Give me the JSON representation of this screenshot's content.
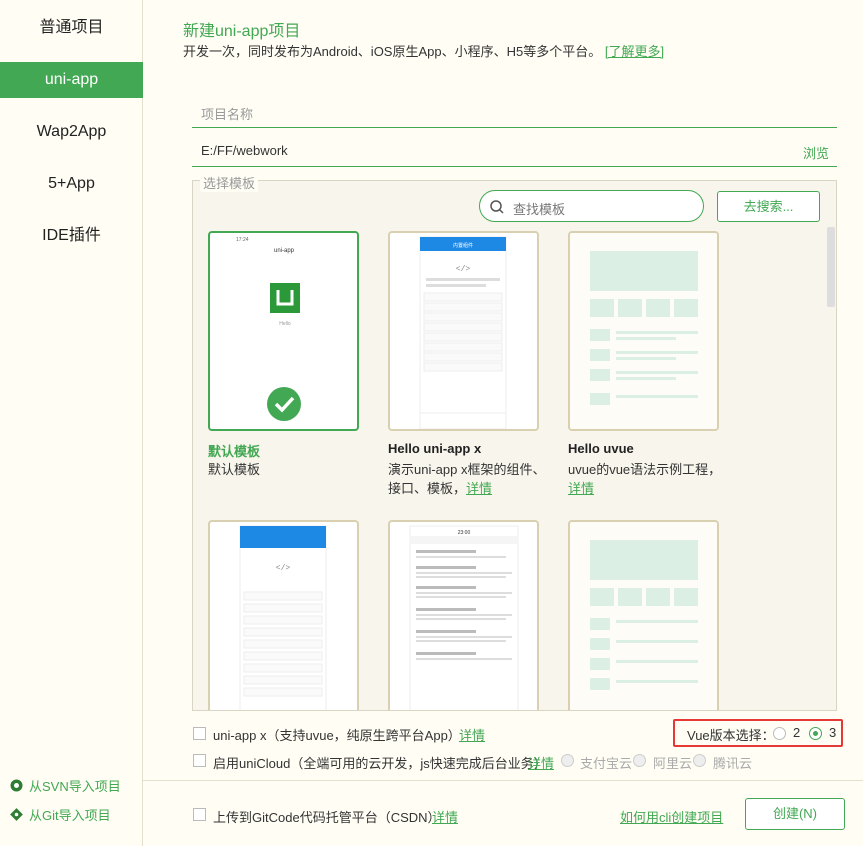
{
  "sidebar": {
    "items": [
      {
        "label": "普通项目"
      },
      {
        "label": "uni-app"
      },
      {
        "label": "Wap2App"
      },
      {
        "label": "5+App"
      },
      {
        "label": "IDE插件"
      }
    ],
    "bottom": [
      {
        "label": "从SVN导入项目",
        "icon": "svn-icon"
      },
      {
        "label": "从Git导入项目",
        "icon": "git-icon"
      }
    ]
  },
  "header": {
    "title": "新建uni-app项目",
    "subtitle": "开发一次，同时发布为Android、iOS原生App、小程序、H5等多个平台。",
    "learn_more": "[了解更多]"
  },
  "form": {
    "project_name_placeholder": "项目名称",
    "path_value": "E:/FF/webwork",
    "browse_label": "浏览"
  },
  "templates": {
    "legend": "选择模板",
    "search_placeholder": "查找模板",
    "search_button": "去搜索...",
    "cards": [
      {
        "name": "默认模板",
        "desc": "默认模板",
        "selected": true
      },
      {
        "name": "Hello uni-app x",
        "desc": "演示uni-app x框架的组件、接口、模板，",
        "link": "详情"
      },
      {
        "name": "Hello uvue",
        "desc": "uvue的vue语法示例工程，",
        "link": "详情"
      }
    ],
    "preview_texts": {
      "default_app_title": "uni-app",
      "default_hello": "Hello",
      "status_time": "17:24",
      "ux_header": "内置组件",
      "ux_time": "23:00",
      "ux_header2": "原生插件演示"
    }
  },
  "options": {
    "unix_label": "uni-app x（支持uvue，纯原生跨平台App）",
    "unix_link": "详情",
    "vue_version_label": "Vue版本选择：",
    "vue_options": [
      "2",
      "3"
    ],
    "vue_selected": "3",
    "unicloud_label": "启用uniCloud（全端可用的云开发，js快速完成后台业务）",
    "unicloud_link": "详情",
    "cloud_options": [
      "支付宝云",
      "阿里云",
      "腾讯云"
    ],
    "gitcode_label": "上传到GitCode代码托管平台（CSDN）",
    "gitcode_link": "详情",
    "cli_link": "如何用cli创建项目",
    "create_button": "创建(N)"
  },
  "colors": {
    "accent": "#42a853",
    "highlight_border": "#e53935",
    "background": "#fffdf4"
  }
}
